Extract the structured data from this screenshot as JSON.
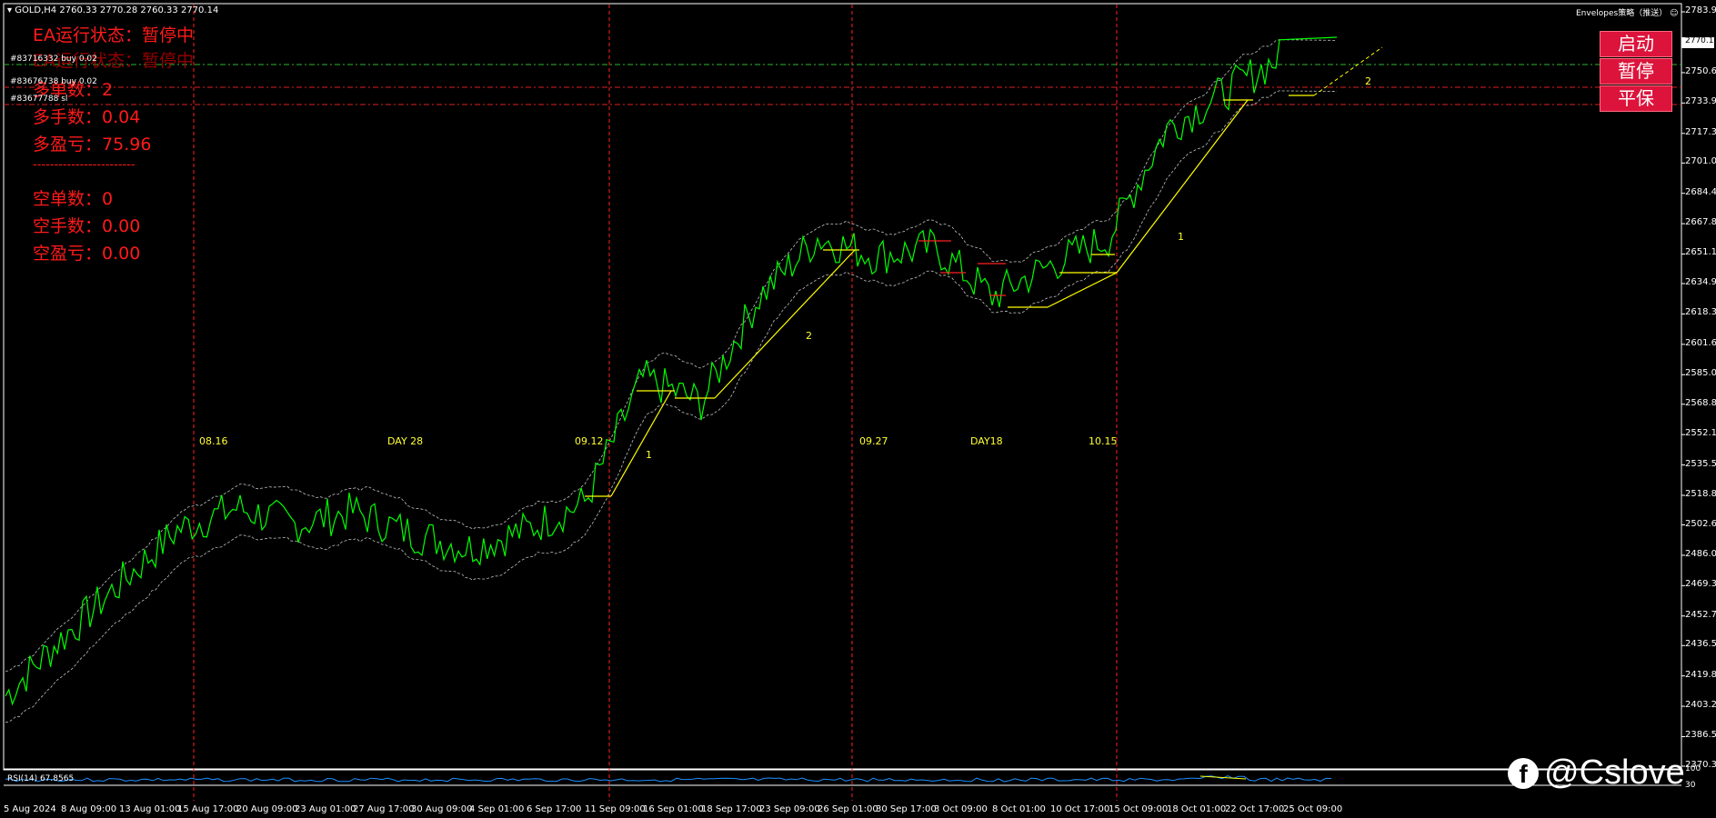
{
  "header": {
    "symbol": "GOLD,H4",
    "ohlc": "2760.33 2770.28 2760.33 2770.14",
    "indicator_label": "Envelopes策略（推送）"
  },
  "ea_panel": {
    "status": "EA运行状态：暂停中",
    "status_ghost": "EA运行状态：暂停中",
    "long_count_label": "多单数：",
    "long_count": "2",
    "long_lots_label": "多手数：",
    "long_lots": "0.04",
    "long_pnl_label": "多盈亏：",
    "long_pnl": "75.96",
    "separator": "------------------------",
    "short_count_label": "空单数：",
    "short_count": "0",
    "short_lots_label": "空手数：",
    "short_lots": "0.00",
    "short_pnl_label": "空盈亏：",
    "short_pnl": "0.00"
  },
  "orders": [
    {
      "label": "#83716332 buy 0.02"
    },
    {
      "label": "#83676738 buy 0.02"
    },
    {
      "label": "#83677788 sl"
    }
  ],
  "buttons": {
    "start": "启动",
    "pause": "暂停",
    "breakeven": "平保"
  },
  "price_axis": {
    "labels": [
      "2783.95",
      "2770.14",
      "2750.60",
      "2733.95",
      "2717.30",
      "2701.05",
      "2684.45",
      "2667.80",
      "2651.15",
      "2634.95",
      "2618.30",
      "2601.65",
      "2585.00",
      "2568.80",
      "2552.15",
      "2535.50",
      "2518.85",
      "2502.65",
      "2486.00",
      "2469.35",
      "2452.70",
      "2436.50",
      "2419.85",
      "2403.20",
      "2386.55",
      "2370.35",
      "100",
      "30"
    ],
    "current": "2770.14",
    "current_color": "#ffffff"
  },
  "date_axis": {
    "labels": [
      "5 Aug 2024",
      "8 Aug 09:00",
      "13 Aug 01:00",
      "15 Aug 17:00",
      "20 Aug 09:00",
      "23 Aug 01:00",
      "27 Aug 17:00",
      "30 Aug 09:00",
      "4 Sep 01:00",
      "6 Sep 17:00",
      "11 Sep 09:00",
      "16 Sep 01:00",
      "18 Sep 17:00",
      "23 Sep 09:00",
      "26 Sep 01:00",
      "30 Sep 17:00",
      "3 Oct 09:00",
      "8 Oct 01:00",
      "10 Oct 17:00",
      "15 Oct 09:00",
      "18 Oct 01:00",
      "22 Oct 17:00",
      "25 Oct 09:00"
    ]
  },
  "annotations": {
    "markers": [
      "08.16",
      "DAY 28",
      "09.12",
      "09.27",
      "DAY18",
      "10.15"
    ],
    "waves": [
      "1",
      "2",
      "1",
      "2"
    ]
  },
  "rsi": {
    "label": "RSI(14) 67.8565"
  },
  "watermark": {
    "text": "@Cslove",
    "icon": "facebook-icon"
  },
  "colors": {
    "background": "#000000",
    "price_line": "#00ff00",
    "envelope": "#c0c0c0",
    "ea_text": "#ff1a1a",
    "button": "#dc143c",
    "vertical_marker": "#ff2020",
    "annotation": "#ffff33",
    "rsi_line": "#1e90ff"
  },
  "chart_data": {
    "type": "line",
    "x": [
      "5 Aug 2024",
      "8 Aug 09:00",
      "13 Aug 01:00",
      "15 Aug 17:00",
      "20 Aug 09:00",
      "23 Aug 01:00",
      "27 Aug 17:00",
      "30 Aug 09:00",
      "4 Sep 01:00",
      "6 Sep 17:00",
      "11 Sep 09:00",
      "16 Sep 01:00",
      "18 Sep 17:00",
      "23 Sep 09:00",
      "26 Sep 01:00",
      "30 Sep 17:00",
      "3 Oct 09:00",
      "8 Oct 01:00",
      "10 Oct 17:00",
      "15 Oct 09:00",
      "18 Oct 01:00",
      "22 Oct 17:00",
      "25 Oct 09:00"
    ],
    "series": [
      {
        "name": "GOLD,H4",
        "values": [
          2409,
          2440,
          2470,
          2500,
          2512,
          2503,
          2510,
          2498,
          2490,
          2500,
          2515,
          2583,
          2570,
          2628,
          2660,
          2650,
          2655,
          2628,
          2645,
          2660,
          2720,
          2740,
          2760
        ]
      }
    ],
    "ylim": [
      2370,
      2790
    ],
    "grid": false
  }
}
